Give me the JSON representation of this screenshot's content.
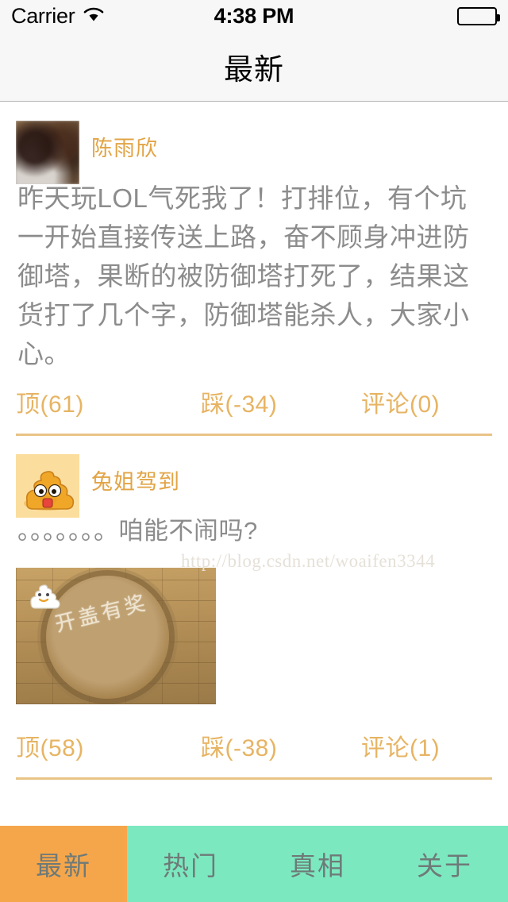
{
  "status_bar": {
    "carrier": "Carrier",
    "wifi_icon": "wifi-icon",
    "time": "4:38 PM",
    "battery_icon": "battery-full-icon"
  },
  "nav_bar": {
    "title": "最新"
  },
  "watermark": "http://blog.csdn.net/woaifen3344",
  "colors": {
    "accent_orange": "#E2A445",
    "action_gold": "#E7B463",
    "divider_gold": "#E8C486",
    "tab_active_bg": "#F5A64B",
    "tab_bg": "#7CE8C0",
    "tab_text": "#6E7A78",
    "body_text": "#8C8C8C",
    "navbar_bg": "#F7F7F7"
  },
  "posts": [
    {
      "avatar_name": "user-photo-avatar",
      "author": "陈雨欣",
      "text": "昨天玩LOL气死我了！打排位，有个坑一开始直接传送上路，奋不顾身冲进防御塔，果断的被防御塔打死了，结果这货打了几个字，防御塔能杀人，大家小心。",
      "has_image": false,
      "actions": {
        "up_label": "顶(61)",
        "down_label": "踩(-34)",
        "comment_label": "评论(0)"
      }
    },
    {
      "avatar_name": "poop-emoji-avatar",
      "author": "兔姐驾到",
      "text": "。。。。。。。咱能不闹吗?",
      "has_image": true,
      "image_caption": "开盖有奖",
      "actions": {
        "up_label": "顶(58)",
        "down_label": "踩(-38)",
        "comment_label": "评论(1)"
      }
    }
  ],
  "tab_bar": {
    "tabs": [
      {
        "label": "最新",
        "active": true
      },
      {
        "label": "热门",
        "active": false
      },
      {
        "label": "真相",
        "active": false
      },
      {
        "label": "关于",
        "active": false
      }
    ]
  }
}
